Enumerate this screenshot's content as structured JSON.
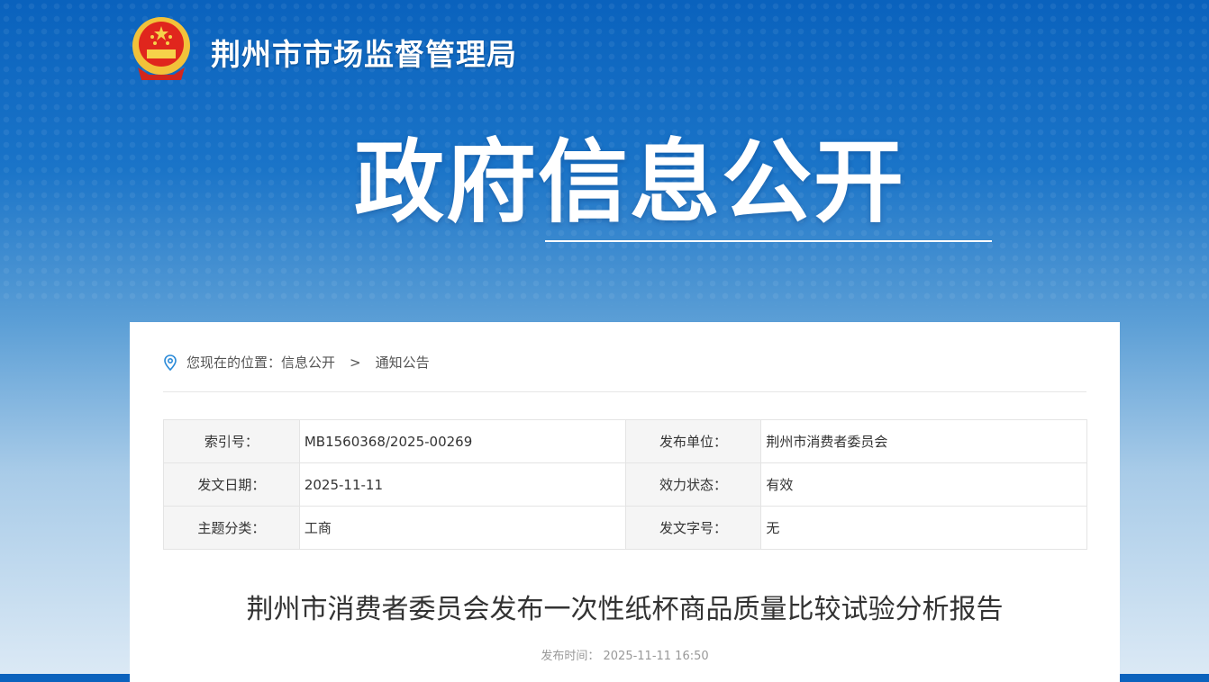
{
  "header": {
    "site_name": "荆州市市场监督管理局",
    "banner_title": "政府信息公开"
  },
  "breadcrumb": {
    "prefix": "您现在的位置：",
    "items": [
      "信息公开",
      "通知公告"
    ],
    "separator": ">"
  },
  "meta": [
    {
      "label": "索引号：",
      "value": "MB1560368/2025-00269",
      "label2": "发布单位：",
      "value2": "荆州市消费者委员会"
    },
    {
      "label": "发文日期：",
      "value": "2025-11-11",
      "label2": "效力状态：",
      "value2": "有效"
    },
    {
      "label": "主题分类：",
      "value": "工商",
      "label2": "发文字号：",
      "value2": "无"
    }
  ],
  "article": {
    "title": "荆州市消费者委员会发布一次性纸杯商品质量比较试验分析报告",
    "publish_label": "发布时间：",
    "publish_time": "2025-11-11 16:50"
  }
}
